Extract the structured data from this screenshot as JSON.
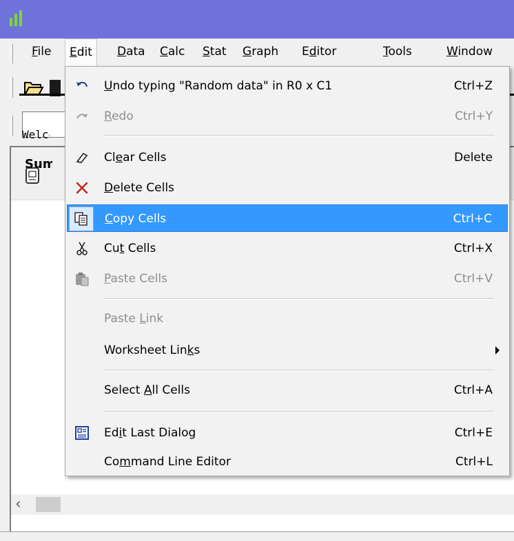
{
  "menubar": {
    "items": [
      {
        "label": "File",
        "mnemonic": "F",
        "rest": "ile"
      },
      {
        "label": "Edit",
        "mnemonic": "E",
        "rest": "dit"
      },
      {
        "label": "Data",
        "mnemonic": "D",
        "rest": "ata"
      },
      {
        "label": "Calc",
        "mnemonic": "C",
        "rest": "alc"
      },
      {
        "label": "Stat",
        "mnemonic": "S",
        "rest": "tat"
      },
      {
        "label": "Graph",
        "mnemonic": "G",
        "rest": "raph"
      },
      {
        "label": "Editor",
        "pre": "E",
        "mnemonic": "d",
        "rest": "itor"
      },
      {
        "label": "Tools",
        "mnemonic": "T",
        "rest": "ools"
      },
      {
        "label": "Window",
        "mnemonic": "W",
        "rest": "indow"
      }
    ]
  },
  "session": {
    "welcome": "Welcome",
    "summary": "Summary"
  },
  "edit_menu": {
    "undo": {
      "pre": "",
      "u": "U",
      "post": "ndo typing \"Random data\" in R0 x C1",
      "shortcut": "Ctrl+Z"
    },
    "redo": {
      "pre": "",
      "u": "R",
      "post": "edo",
      "shortcut": "Ctrl+Y"
    },
    "clear": {
      "pre": "Cl",
      "u": "e",
      "post": "ar Cells",
      "shortcut": "Delete"
    },
    "delete": {
      "pre": "",
      "u": "D",
      "post": "elete Cells",
      "shortcut": ""
    },
    "copy": {
      "pre": "",
      "u": "C",
      "post": "opy Cells",
      "shortcut": "Ctrl+C"
    },
    "cut": {
      "pre": "Cu",
      "u": "t",
      "post": " Cells",
      "shortcut": "Ctrl+X"
    },
    "paste": {
      "pre": "",
      "u": "P",
      "post": "aste Cells",
      "shortcut": "Ctrl+V"
    },
    "paste_link": {
      "pre": "Paste ",
      "u": "L",
      "post": "ink",
      "shortcut": ""
    },
    "worksheet_links": {
      "pre": "Worksheet Lin",
      "u": "k",
      "post": "s",
      "shortcut": ""
    },
    "select_all": {
      "pre": "Select ",
      "u": "A",
      "post": "ll Cells",
      "shortcut": "Ctrl+A"
    },
    "edit_last": {
      "pre": "Ed",
      "u": "i",
      "post": "t Last Dialog",
      "shortcut": "Ctrl+E"
    },
    "cmd_line": {
      "pre": "Co",
      "u": "m",
      "post": "mand Line Editor",
      "shortcut": "Ctrl+L"
    }
  },
  "colors": {
    "titlebar": "#6f73d9",
    "highlight": "#3399ff",
    "disabled_text": "#8d8d8d"
  }
}
